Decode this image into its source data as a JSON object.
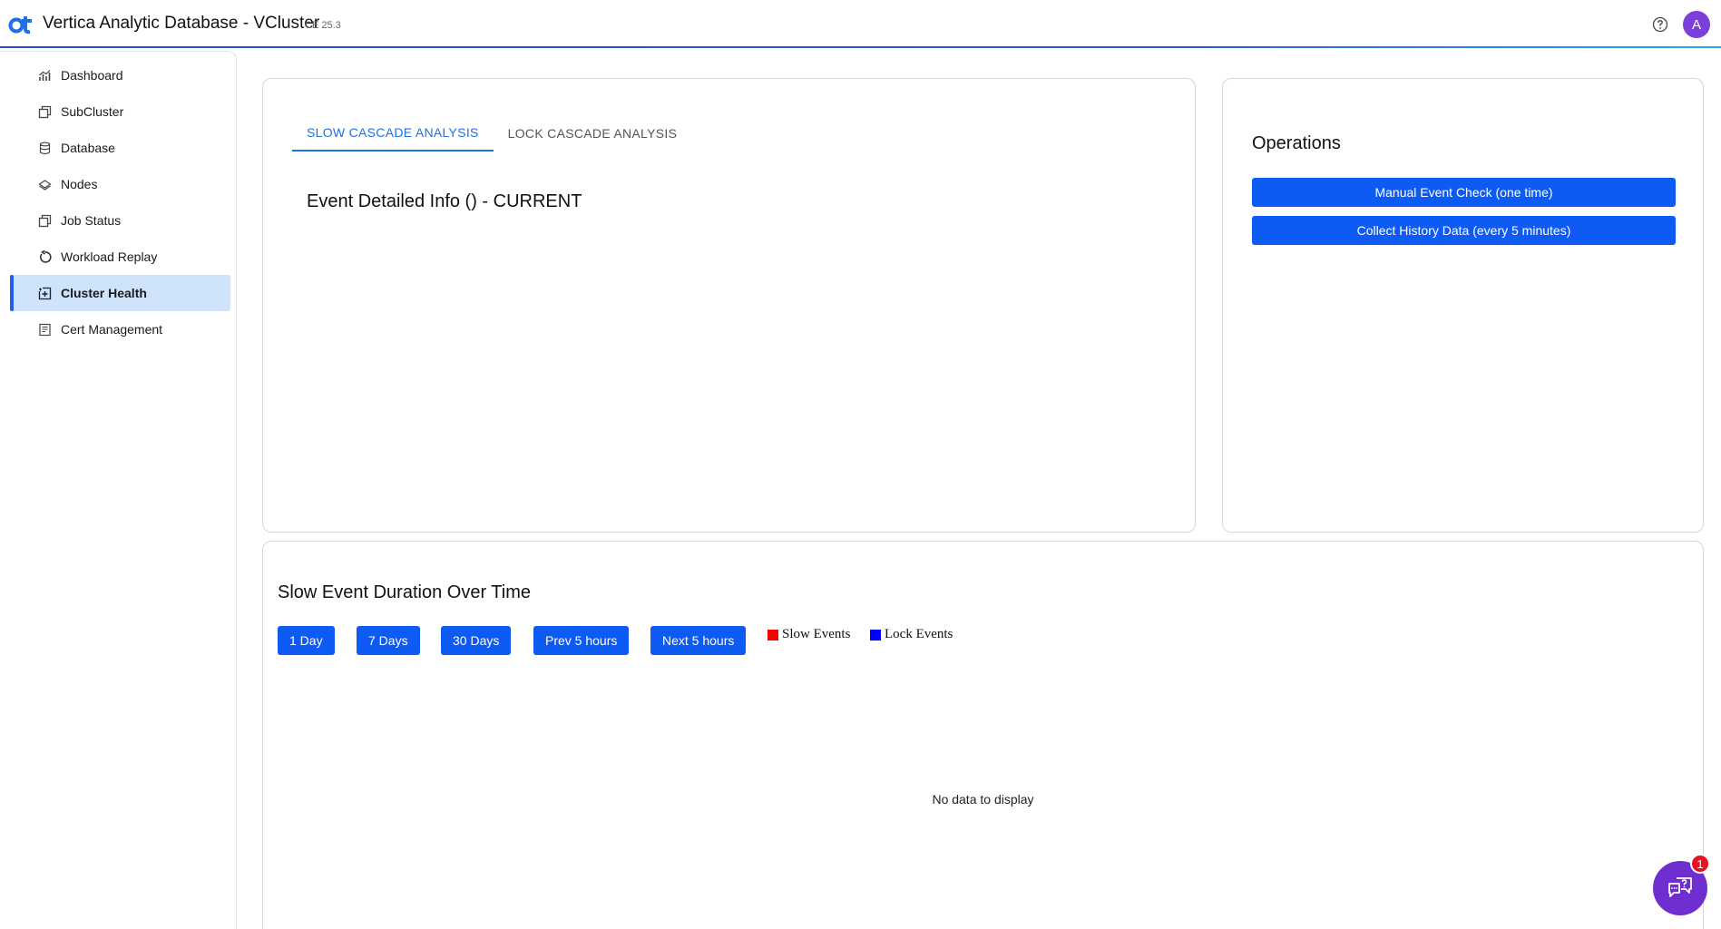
{
  "header": {
    "app_title": "Vertica Analytic Database - VCluster",
    "version": "CE 25.3",
    "avatar_initial": "A"
  },
  "sidebar": {
    "items": [
      {
        "label": "Dashboard",
        "icon": "chart-icon"
      },
      {
        "label": "SubCluster",
        "icon": "copy-icon"
      },
      {
        "label": "Database",
        "icon": "database-icon"
      },
      {
        "label": "Nodes",
        "icon": "layers-icon"
      },
      {
        "label": "Job Status",
        "icon": "copy-icon"
      },
      {
        "label": "Workload Replay",
        "icon": "replay-icon"
      },
      {
        "label": "Cluster Health",
        "icon": "health-icon",
        "active": true
      },
      {
        "label": "Cert Management",
        "icon": "certificate-icon"
      }
    ]
  },
  "events": {
    "tabs": [
      {
        "label": "SLOW CASCADE ANALYSIS",
        "active": true
      },
      {
        "label": "LOCK CASCADE ANALYSIS"
      }
    ],
    "title": "Event Detailed Info () - CURRENT"
  },
  "operations": {
    "title": "Operations",
    "buttons": [
      "Manual Event Check (one time)",
      "Collect History Data (every 5 minutes)"
    ]
  },
  "chart": {
    "title": "Slow Event Duration Over Time",
    "ranges": [
      "1 Day",
      "7 Days",
      "30 Days",
      "Prev 5 hours",
      "Next 5 hours"
    ],
    "legend": [
      {
        "label": "Slow Events",
        "color": "#ff0000"
      },
      {
        "label": "Lock Events",
        "color": "#0000ff"
      }
    ],
    "empty_text": "No data to display"
  },
  "chat": {
    "badge_count": "1"
  },
  "colors": {
    "accent": "#0d5bf2",
    "active_nav_bg": "#cfe3fb",
    "avatar": "#7c3fd9",
    "chat": "#6f2fd0"
  }
}
